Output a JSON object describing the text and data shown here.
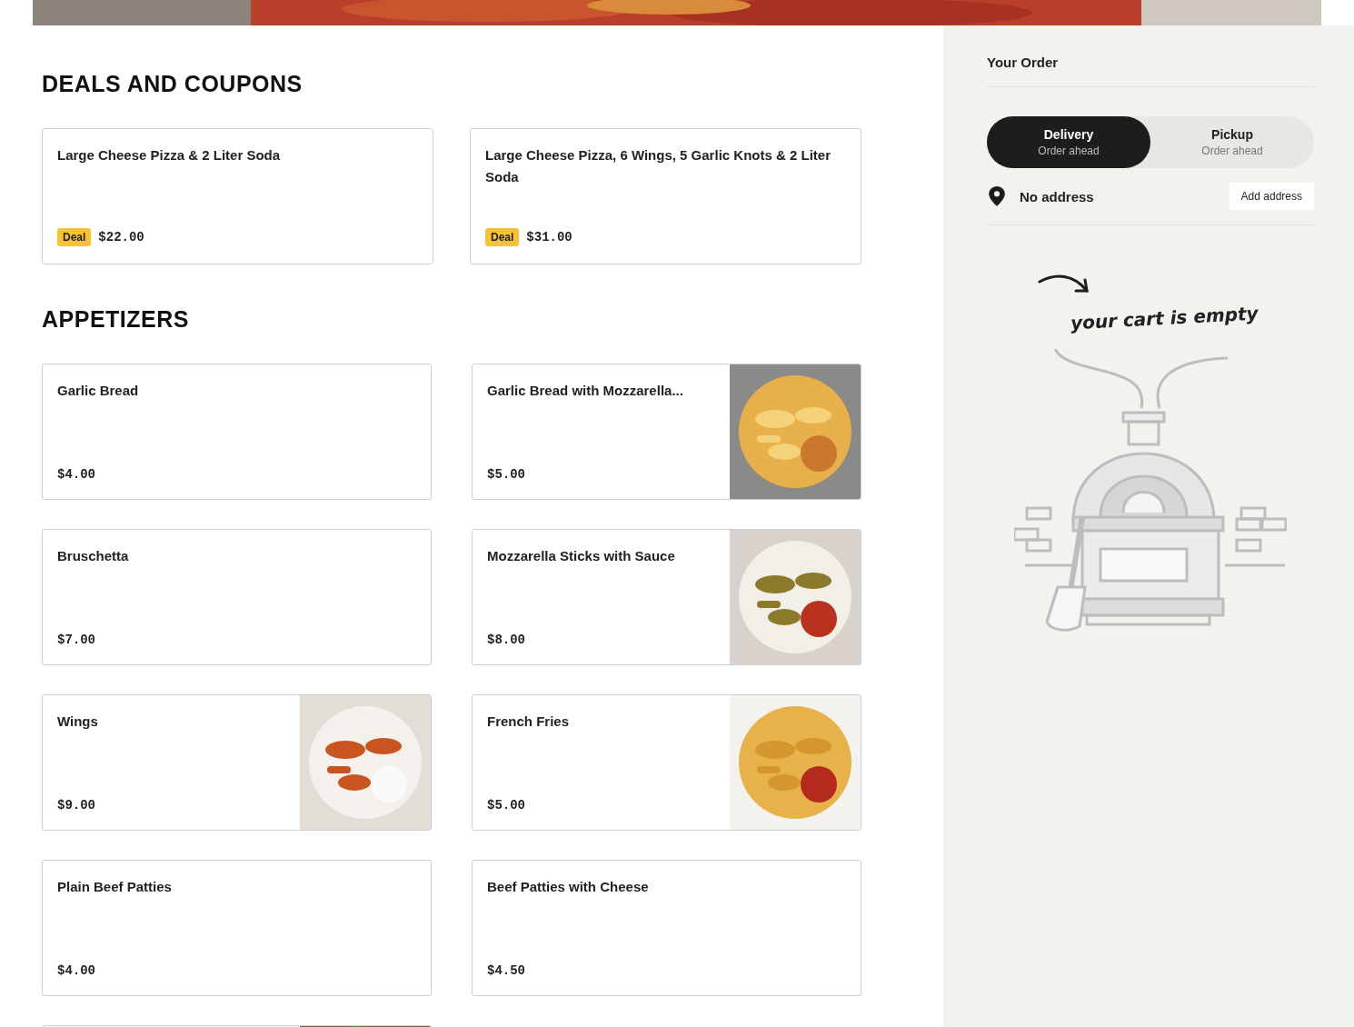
{
  "sections": [
    {
      "title": "DEALS AND COUPONS",
      "kind": "deals",
      "items": [
        {
          "name": "Large Cheese Pizza & 2 Liter Soda",
          "badge": "Deal",
          "price": "$22.00"
        },
        {
          "name": "Large Cheese Pizza, 6 Wings, 5 Garlic Knots & 2 Liter Soda",
          "badge": "Deal",
          "price": "$31.00"
        }
      ]
    },
    {
      "title": "APPETIZERS",
      "kind": "menu",
      "items": [
        {
          "name": "Garlic Bread",
          "price": "$4.00"
        },
        {
          "name": "Garlic Bread with Mozzarella...",
          "price": "$5.00",
          "image": true
        },
        {
          "name": "Bruschetta",
          "price": "$7.00"
        },
        {
          "name": "Mozzarella Sticks with Sauce",
          "price": "$8.00",
          "image": true
        },
        {
          "name": "Wings",
          "price": "$9.00",
          "image": true
        },
        {
          "name": "French Fries",
          "price": "$5.00",
          "image": true
        },
        {
          "name": "Plain Beef Patties",
          "price": "$4.00"
        },
        {
          "name": "Beef Patties with Cheese",
          "price": "$4.50"
        },
        {
          "image": true
        }
      ]
    }
  ],
  "order": {
    "title": "Your Order",
    "modes": [
      {
        "label": "Delivery",
        "sub": "Order ahead",
        "selected": true
      },
      {
        "label": "Pickup",
        "sub": "Order ahead",
        "selected": false
      }
    ],
    "address": "No address",
    "address_button": "Add address",
    "empty_text": "your cart is empty"
  }
}
